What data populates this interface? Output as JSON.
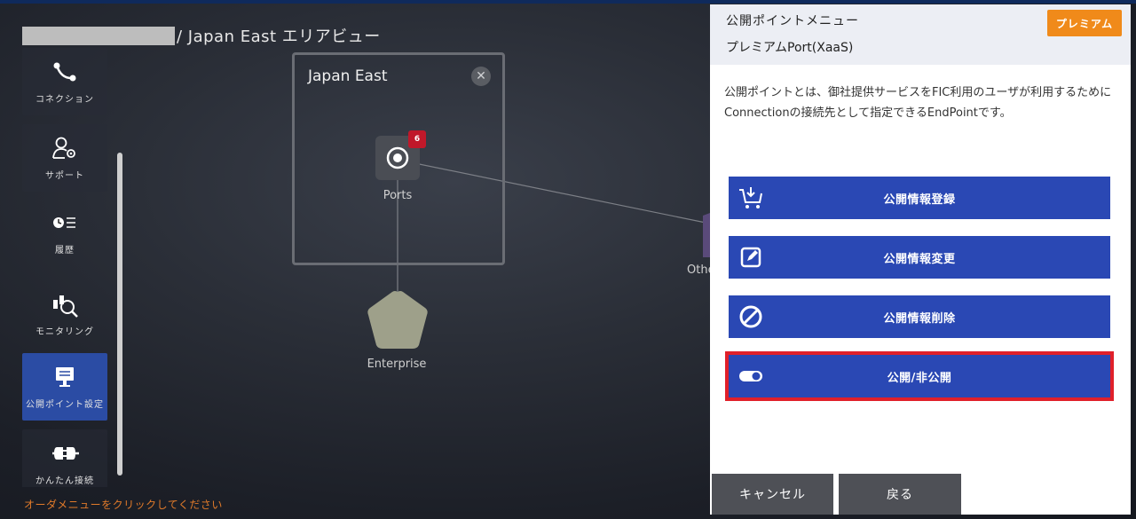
{
  "breadcrumb": {
    "text": "/ Japan East エリアビュー"
  },
  "sidebar": {
    "items": [
      {
        "label": "コネクション",
        "icon": "connection-icon"
      },
      {
        "label": "サポート",
        "icon": "support-icon"
      },
      {
        "label": "履歴",
        "icon": "history-icon"
      },
      {
        "label": "モニタリング",
        "icon": "monitoring-icon"
      },
      {
        "label": "公開ポイント設定",
        "icon": "public-point-icon",
        "active": true
      },
      {
        "label": "かんたん接続",
        "icon": "easy-connect-icon"
      }
    ]
  },
  "hint": "オーダメニューをクリックしてください",
  "canvas": {
    "area_title": "Japan East",
    "ports_label": "Ports",
    "ports_badge": "6",
    "enterprise_label": "Enterprise",
    "other_label": "Othe"
  },
  "panel": {
    "title": "公開ポイントメニュー",
    "subtitle": "プレミアムPort(XaaS)",
    "badge": "プレミアム",
    "description": "公開ポイントとは、御社提供サービスをFIC利用のユーザが利用するためにConnectionの接続先として指定できるEndPointです。",
    "actions": [
      {
        "label": "公開情報登録",
        "icon": "cart-download-icon"
      },
      {
        "label": "公開情報変更",
        "icon": "edit-icon"
      },
      {
        "label": "公開情報削除",
        "icon": "prohibited-icon"
      },
      {
        "label": "公開/非公開",
        "icon": "toggle-icon",
        "highlighted": true
      }
    ],
    "cancel_label": "キャンセル",
    "back_label": "戻る"
  },
  "colors": {
    "accent": "#2a48b4",
    "premium": "#f08a1a",
    "highlight": "#e0202a",
    "badge": "#c0182a"
  }
}
